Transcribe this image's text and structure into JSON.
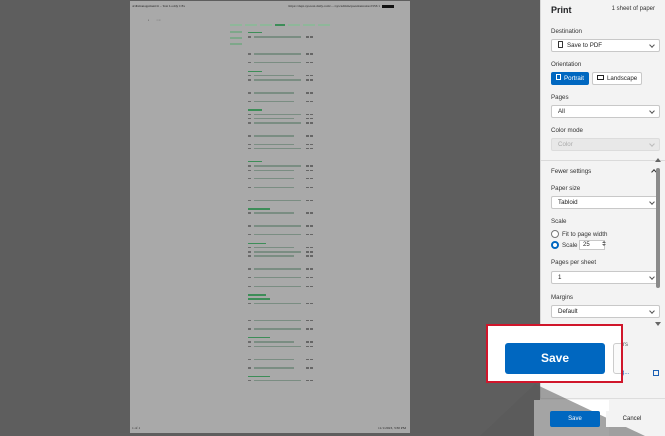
{
  "preview": {
    "header_left": "4/dbmanagement/it – Test Loddy CEs",
    "header_right": "https://dept.sys.test.daily.com/…/sys/admin/questionnaire/2333/1",
    "footer_left": "1 of 1",
    "footer_right": "11/1/2023, 3:30 PM"
  },
  "panel": {
    "title": "Print",
    "sheet_count": "1 sheet of paper",
    "destination": {
      "label": "Destination",
      "value": "Save to PDF"
    },
    "orientation": {
      "label": "Orientation",
      "portrait": "Portrait",
      "landscape": "Landscape"
    },
    "pages": {
      "label": "Pages",
      "value": "All"
    },
    "color_mode": {
      "label": "Color mode",
      "value": "Color"
    },
    "fewer_settings": "Fewer settings",
    "paper_size": {
      "label": "Paper size",
      "value": "Tabloid"
    },
    "scale": {
      "label": "Scale",
      "fit_option": "Fit to page width",
      "scale_option": "Scale",
      "value": "25"
    },
    "pages_per_sheet": {
      "label": "Pages per sheet",
      "value": "1"
    },
    "margins": {
      "label": "Margins",
      "value": "Default"
    },
    "peek_a": "rs",
    "peek_b": "g..."
  },
  "actions": {
    "save": "Save",
    "cancel": "Cancel"
  },
  "colors": {
    "accent": "#0067c0",
    "callout_border": "#d0162b",
    "preview_bg": "#5e5e5e",
    "panel_bg": "#f3f3f3"
  }
}
